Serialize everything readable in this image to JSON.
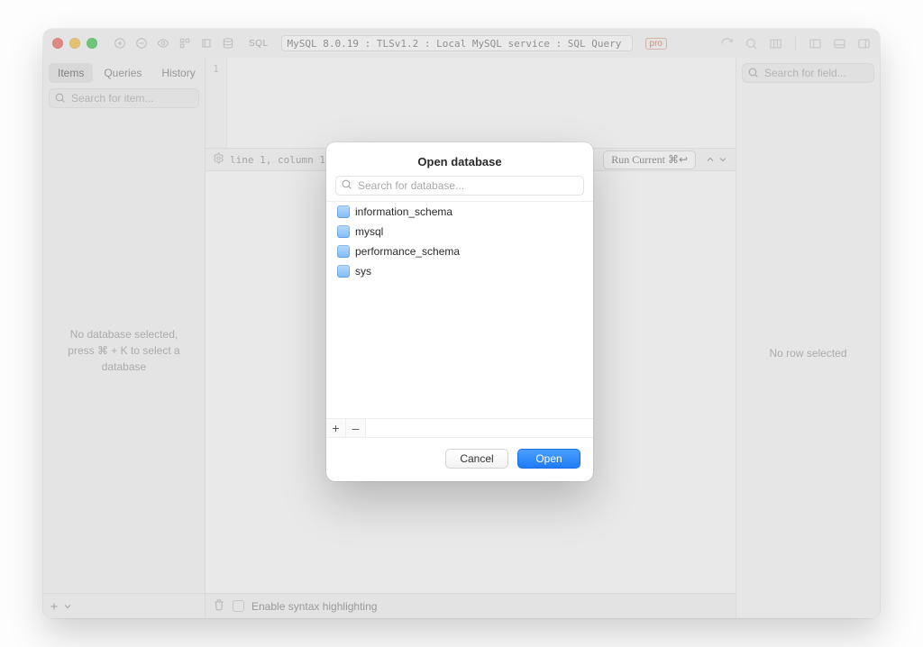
{
  "toolbar": {
    "sql_badge": "SQL",
    "address": "MySQL 8.0.19 : TLSv1.2 : Local MySQL service : SQL Query",
    "pro": "pro"
  },
  "sidebar": {
    "tabs": {
      "items": "Items",
      "queries": "Queries",
      "history": "History"
    },
    "search_placeholder": "Search for item...",
    "empty": "No database selected,\npress ⌘ + K to select a\ndatabase"
  },
  "editor": {
    "line_number": "1",
    "status": "line 1, column 1,",
    "run_label": "Run Current ⌘↩",
    "footer_label": "Enable syntax highlighting"
  },
  "right": {
    "search_placeholder": "Search for field...",
    "empty": "No row selected"
  },
  "modal": {
    "title": "Open database",
    "search_placeholder": "Search for database...",
    "databases": [
      "information_schema",
      "mysql",
      "performance_schema",
      "sys"
    ],
    "cancel": "Cancel",
    "open": "Open",
    "plus": "+",
    "minus": "–"
  }
}
